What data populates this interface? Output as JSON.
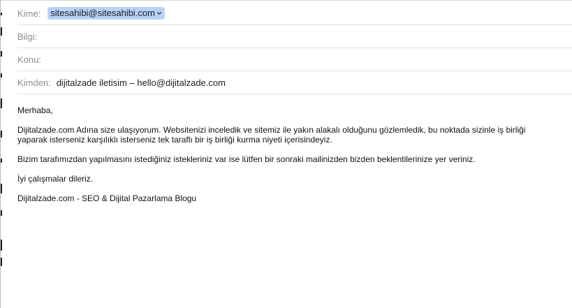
{
  "header": {
    "to_label": "Kime:",
    "to_recipient": "sitesahibi@sitesahibi.com",
    "cc_label": "Bilgi:",
    "cc_value": "",
    "subject_label": "Konu:",
    "subject_value": "",
    "from_label": "Kimden:",
    "from_value": "dijitalzade iletisim – hello@dijitalzade.com"
  },
  "message": {
    "greeting": "Merhaba,",
    "paragraph1_line1": "Dijitalzade.com Adına size ulaşıyorum. Websitenizi inceledik ve sitemiz ile yakın alakalı olduğunu gözlemledik, bu noktada sizinle iş birliği",
    "paragraph1_line2": "yaparak isterseniz karşılıklı isterseniz tek taraflı bir iş birliği kurma niyeti içerisindeyiz.",
    "paragraph2": "Bizim tarafımızdan yapılmasını istediğiniz istekleriniz var ise lütfen bir sonraki mailinizden bizden beklentilerinize yer veriniz.",
    "closing": "İyi çalışmalar dileriz.",
    "signature": "Dijitalzade.com - SEO & Dijital Pazarlama Blogu"
  },
  "colors": {
    "token_background": "#b7d3f9",
    "label_gray": "#8d8d8d",
    "divider": "#e2e2e2"
  }
}
